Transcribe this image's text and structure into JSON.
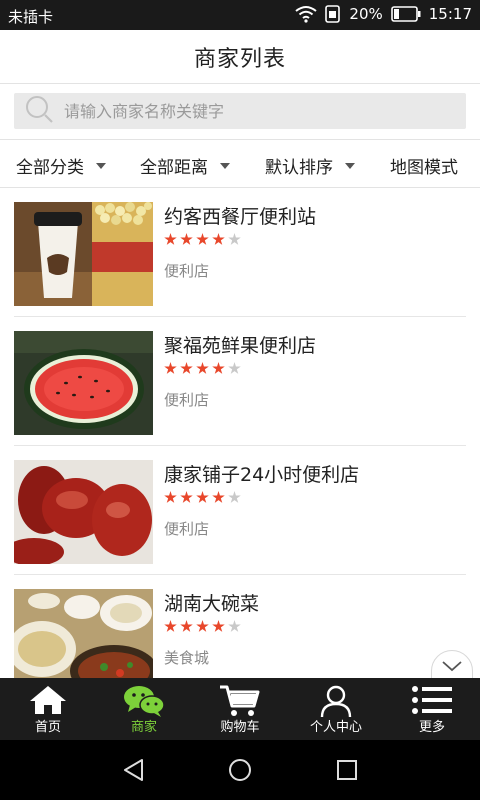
{
  "status_bar": {
    "carrier": "未插卡",
    "battery": "20%",
    "time": "15:17"
  },
  "header": {
    "title": "商家列表"
  },
  "search": {
    "placeholder": "请输入商家名称关键字"
  },
  "filters": [
    {
      "label": "全部分类"
    },
    {
      "label": "全部距离"
    },
    {
      "label": "默认排序"
    },
    {
      "label": "地图模式"
    }
  ],
  "merchants": [
    {
      "name": "约客西餐厅便利站",
      "rating": 4,
      "max_rating": 5,
      "category": "便利店",
      "image": "coffee-popcorn"
    },
    {
      "name": "聚福苑鲜果便利店",
      "rating": 4,
      "max_rating": 5,
      "category": "便利店",
      "image": "watermelon"
    },
    {
      "name": "康家铺子24小时便利店",
      "rating": 4,
      "max_rating": 5,
      "category": "便利店",
      "image": "red-dates"
    },
    {
      "name": "湖南大碗菜",
      "rating": 4,
      "max_rating": 5,
      "category": "美食城",
      "image": "dishes"
    }
  ],
  "bottom_nav": [
    {
      "label": "首页",
      "icon": "home-icon",
      "active": false
    },
    {
      "label": "商家",
      "icon": "chat-icon",
      "active": true
    },
    {
      "label": "购物车",
      "icon": "cart-icon",
      "active": false
    },
    {
      "label": "个人中心",
      "icon": "user-icon",
      "active": false
    },
    {
      "label": "更多",
      "icon": "menu-icon",
      "active": false
    }
  ],
  "colors": {
    "star_on": "#e8472b",
    "star_off": "#c9c9c9",
    "nav_active": "#7dd13a",
    "nav_bg": "#1c1c1c"
  }
}
